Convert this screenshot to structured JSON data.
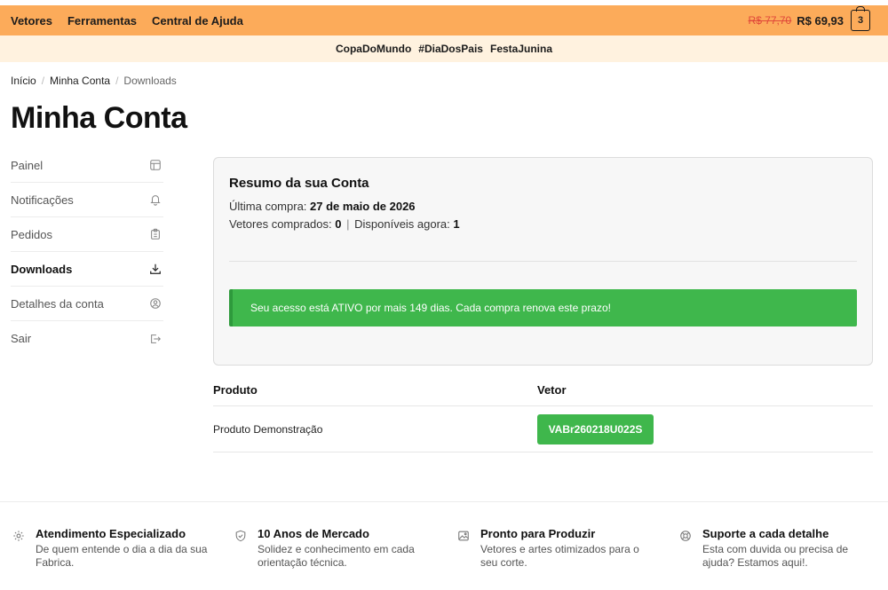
{
  "topbar": {
    "nav": [
      "Vetores",
      "Ferramentas",
      "Central de Ajuda"
    ],
    "old_price": "R$ 77,70",
    "new_price": "R$ 69,93",
    "cart_count": "3"
  },
  "tags": [
    "CopaDoMundo",
    "#DiaDosPais",
    "FestaJunina"
  ],
  "breadcrumb": {
    "home": "Início",
    "account": "Minha Conta",
    "current": "Downloads"
  },
  "page_title": "Minha Conta",
  "sidebar": {
    "items": [
      {
        "label": "Painel",
        "icon": "dashboard-icon"
      },
      {
        "label": "Notificações",
        "icon": "bell-icon"
      },
      {
        "label": "Pedidos",
        "icon": "clipboard-icon"
      },
      {
        "label": "Downloads",
        "icon": "download-icon"
      },
      {
        "label": "Detalhes da conta",
        "icon": "user-circle-icon"
      },
      {
        "label": "Sair",
        "icon": "logout-icon"
      }
    ],
    "active_index": 3
  },
  "summary": {
    "title": "Resumo da sua Conta",
    "last_purchase_label": "Última compra: ",
    "last_purchase_value": "27 de maio de 2026",
    "bought_label": "Vetores comprados: ",
    "bought_value": "0",
    "available_label": "Disponíveis agora: ",
    "available_value": "1",
    "alert": "Seu acesso está ATIVO por mais 149 dias. Cada compra renova este prazo!"
  },
  "table": {
    "headers": [
      "Produto",
      "Vetor"
    ],
    "rows": [
      {
        "product": "Produto Demonstração",
        "vetor": "VABr260218U022S"
      }
    ]
  },
  "footer": {
    "features": [
      {
        "title": "Atendimento Especializado",
        "text": "De quem entende o dia a dia da sua Fabrica.",
        "icon": "gear-icon"
      },
      {
        "title": "10 Anos de Mercado",
        "text": "Solidez e conhecimento em cada orientação técnica.",
        "icon": "shield-check-icon"
      },
      {
        "title": "Pronto para Produzir",
        "text": "Vetores e artes otimizados para o seu corte.",
        "icon": "image-icon"
      },
      {
        "title": "Suporte a cada detalhe",
        "text": "Esta com duvida ou precisa de ajuda? Estamos aqui!.",
        "icon": "lifebuoy-icon"
      }
    ]
  },
  "colors": {
    "accent": "#fcab5a",
    "tag_bg": "#fff2df",
    "success": "#3fb74c",
    "old_price": "#e0483a"
  }
}
